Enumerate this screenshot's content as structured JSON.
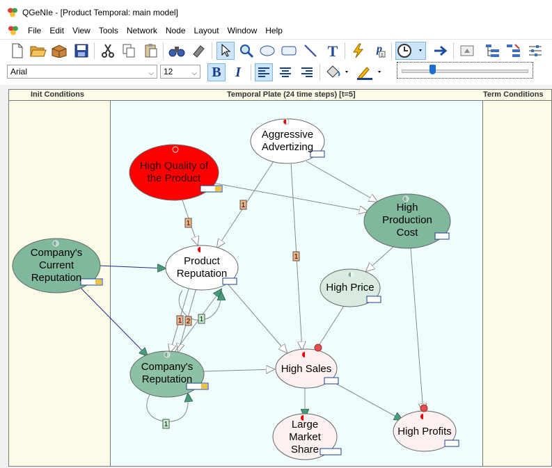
{
  "window": {
    "title": "QGeNIe - [Product Temporal: main model]"
  },
  "menu": [
    "File",
    "Edit",
    "View",
    "Tools",
    "Network",
    "Node",
    "Layout",
    "Window",
    "Help"
  ],
  "format_bar": {
    "font": "Arial",
    "size": "12"
  },
  "plate": {
    "init_label": "Init Conditions",
    "temporal_label": "Temporal Plate (24 time steps) [t=5]",
    "term_label": "Term Conditions"
  },
  "nodes": {
    "aggressive": {
      "label": "Aggressive Advertizing",
      "color": "#ffffff"
    },
    "quality": {
      "label": "High Quality of the Product",
      "color": "#ff0000"
    },
    "production": {
      "label": "High Production Cost",
      "color": "#7fb89c"
    },
    "current_rep": {
      "label": "Company's Current Reputation",
      "color": "#7fb89c"
    },
    "product_rep": {
      "label": "Product Reputation",
      "color": "#ffffff"
    },
    "high_price": {
      "label": "High Price",
      "color": "#d9ebe0"
    },
    "company_rep": {
      "label": "Company's Reputation",
      "color": "#8cc1a6"
    },
    "high_sales": {
      "label": "High Sales",
      "color": "#fdf0f0"
    },
    "market_share": {
      "label": "Large Market Share",
      "color": "#fdf0f0"
    },
    "high_profits": {
      "label": "High Profits",
      "color": "#fdf0f0"
    }
  },
  "arc_labels": {
    "adv_to_prodrep": "1",
    "quality_to_prodrep": "1",
    "adv_to_sales": "1",
    "prodrep_loop_a": "1",
    "prodrep_loop_b": "2",
    "prodrep_loop_c": "1",
    "company_loop": "1"
  },
  "colors": {
    "accent": "#1a6fd0",
    "arc_dark": "#1e2a8c",
    "arc": "#888888"
  }
}
